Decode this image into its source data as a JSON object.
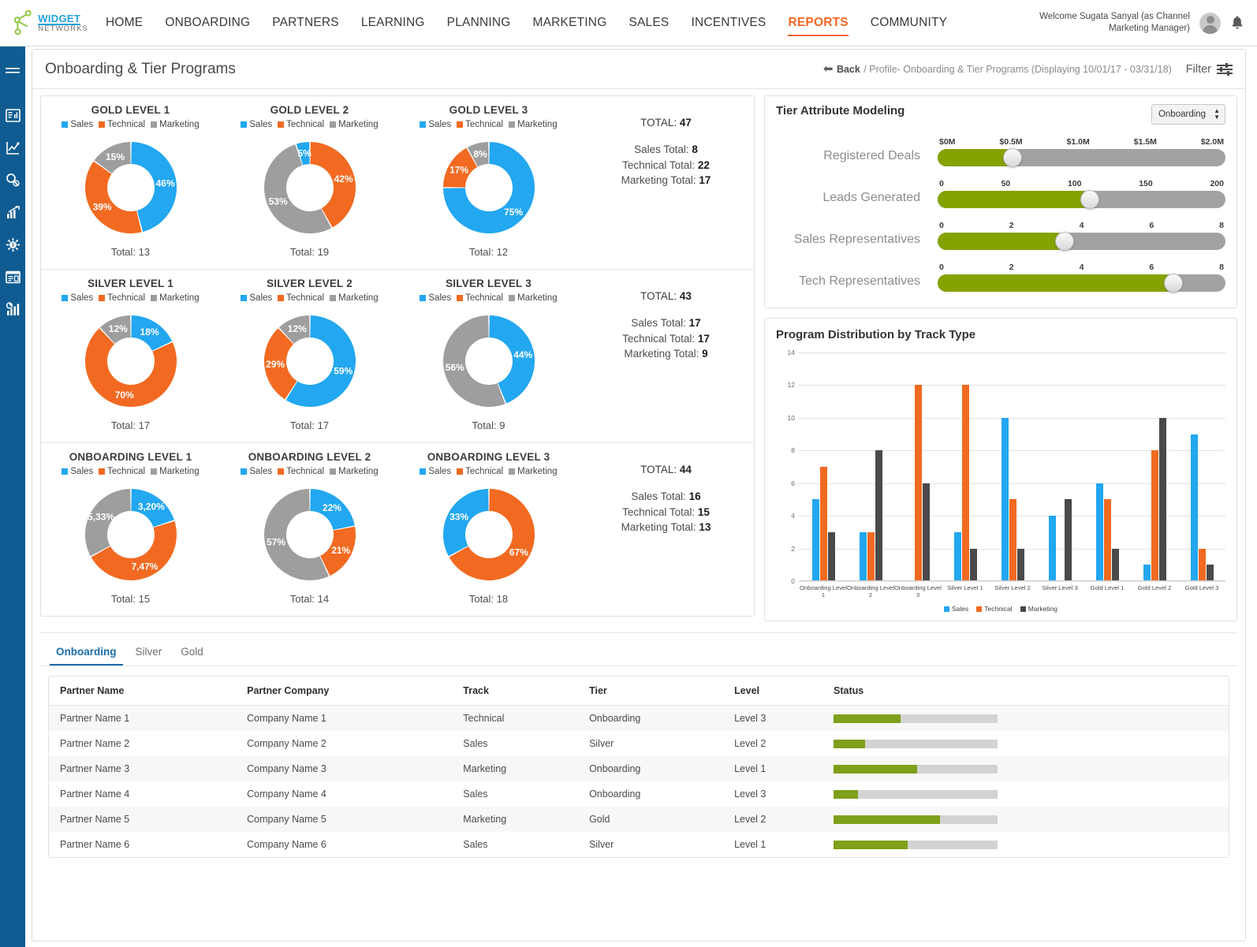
{
  "brand": {
    "name_top": "WIDGET",
    "name_bottom": "NETWORKS"
  },
  "nav": {
    "items": [
      {
        "label": "HOME",
        "active": false
      },
      {
        "label": "ONBOARDING",
        "active": false
      },
      {
        "label": "PARTNERS",
        "active": false
      },
      {
        "label": "LEARNING",
        "active": false
      },
      {
        "label": "PLANNING",
        "active": false
      },
      {
        "label": "MARKETING",
        "active": false
      },
      {
        "label": "SALES",
        "active": false
      },
      {
        "label": "INCENTIVES",
        "active": false
      },
      {
        "label": "REPORTS",
        "active": true
      },
      {
        "label": "COMMUNITY",
        "active": false
      }
    ],
    "welcome_line1": "Welcome Sugata Sanyal (as Channel",
    "welcome_line2": "Marketing Manager)",
    "accent_color": "#f26722"
  },
  "sidebar": {
    "items": [
      {
        "name": "hamburger-menu"
      },
      {
        "name": "report-invoice-icon"
      },
      {
        "name": "line-chart-icon"
      },
      {
        "name": "search-money-icon"
      },
      {
        "name": "growth-chart-icon"
      },
      {
        "name": "gear-money-icon"
      },
      {
        "name": "document-report-icon"
      },
      {
        "name": "bar-chart-icon"
      }
    ]
  },
  "page": {
    "title": "Onboarding & Tier Programs",
    "back_label": "Back",
    "breadcrumb": "/ Profile- Onboarding & Tier Programs (Displaying 10/01/17 - 03/31/18)",
    "filter_label": "Filter"
  },
  "legend": {
    "sales": "Sales",
    "technical": "Technical",
    "marketing": "Marketing"
  },
  "colors": {
    "sales": "#22a7f0",
    "technical": "#f26a21",
    "marketing": "#9e9e9e",
    "green": "#84a200",
    "bar_marketing": "#4a4a4a"
  },
  "donut_rows": [
    {
      "cells": [
        {
          "title": "GOLD LEVEL 1",
          "total_label": "Total: 13",
          "segments": [
            {
              "series": "sales",
              "pct": 46,
              "label": "46%"
            },
            {
              "series": "technical",
              "pct": 39,
              "label": "39%"
            },
            {
              "series": "marketing",
              "pct": 15,
              "label": "15%"
            }
          ]
        },
        {
          "title": "GOLD LEVEL 2",
          "total_label": "Total: 19",
          "segments": [
            {
              "series": "technical",
              "pct": 42,
              "label": "42%"
            },
            {
              "series": "marketing",
              "pct": 53,
              "label": "53%"
            },
            {
              "series": "sales",
              "pct": 5,
              "label": "5%"
            }
          ]
        },
        {
          "title": "GOLD LEVEL 3",
          "total_label": "Total: 12",
          "segments": [
            {
              "series": "sales",
              "pct": 75,
              "label": "75%"
            },
            {
              "series": "technical",
              "pct": 17,
              "label": "17%"
            },
            {
              "series": "marketing",
              "pct": 8,
              "label": "8%"
            }
          ]
        }
      ],
      "totals": {
        "total_label": "TOTAL:",
        "total_value": "47",
        "sales": "Sales Total:",
        "sales_value": "8",
        "technical": "Technical Total:",
        "technical_value": "22",
        "marketing": "Marketing Total:",
        "marketing_value": "17"
      }
    },
    {
      "cells": [
        {
          "title": "SILVER LEVEL 1",
          "total_label": "Total: 17",
          "segments": [
            {
              "series": "sales",
              "pct": 18,
              "label": "18%"
            },
            {
              "series": "technical",
              "pct": 70,
              "label": "70%"
            },
            {
              "series": "marketing",
              "pct": 12,
              "label": "12%"
            }
          ]
        },
        {
          "title": "SILVER LEVEL 2",
          "total_label": "Total: 17",
          "segments": [
            {
              "series": "sales",
              "pct": 59,
              "label": "59%"
            },
            {
              "series": "technical",
              "pct": 29,
              "label": "29%"
            },
            {
              "series": "marketing",
              "pct": 12,
              "label": "12%"
            }
          ]
        },
        {
          "title": "SILVER LEVEL 3",
          "total_label": "Total: 9",
          "segments": [
            {
              "series": "sales",
              "pct": 44,
              "label": "44%"
            },
            {
              "series": "marketing",
              "pct": 56,
              "label": "56%"
            }
          ]
        }
      ],
      "totals": {
        "total_label": "TOTAL:",
        "total_value": "43",
        "sales": "Sales Total:",
        "sales_value": "17",
        "technical": "Technical Total:",
        "technical_value": "17",
        "marketing": "Marketing Total:",
        "marketing_value": "9"
      }
    },
    {
      "cells": [
        {
          "title": "ONBOARDING LEVEL 1",
          "total_label": "Total: 15",
          "segments": [
            {
              "series": "sales",
              "pct": 20,
              "label": "3,20%"
            },
            {
              "series": "technical",
              "pct": 47,
              "label": "7,47%"
            },
            {
              "series": "marketing",
              "pct": 33,
              "label": "5,33%"
            }
          ]
        },
        {
          "title": "ONBOARDING LEVEL 2",
          "total_label": "Total: 14",
          "segments": [
            {
              "series": "sales",
              "pct": 22,
              "label": "22%"
            },
            {
              "series": "technical",
              "pct": 21,
              "label": "21%"
            },
            {
              "series": "marketing",
              "pct": 57,
              "label": "57%"
            }
          ]
        },
        {
          "title": "ONBOARDING LEVEL 3",
          "total_label": "Total: 18",
          "segments": [
            {
              "series": "technical",
              "pct": 67,
              "label": "67%"
            },
            {
              "series": "sales",
              "pct": 33,
              "label": "33%"
            }
          ]
        }
      ],
      "totals": {
        "total_label": "TOTAL:",
        "total_value": "44",
        "sales": "Sales Total:",
        "sales_value": "16",
        "technical": "Technical Total:",
        "technical_value": "15",
        "marketing": "Marketing Total:",
        "marketing_value": "13"
      }
    }
  ],
  "tier_modeling": {
    "title": "Tier Attribute Modeling",
    "selected": "Onboarding",
    "sliders": [
      {
        "label": "Registered Deals",
        "ticks": [
          "$0M",
          "$0.5M",
          "$1.0M",
          "$1.5M",
          "$2.0M"
        ],
        "value_pct": 26
      },
      {
        "label": "Leads Generated",
        "ticks": [
          "0",
          "50",
          "100",
          "150",
          "200"
        ],
        "value_pct": 53
      },
      {
        "label": "Sales Representatives",
        "ticks": [
          "0",
          "2",
          "4",
          "6",
          "8"
        ],
        "value_pct": 44
      },
      {
        "label": "Tech Representatives",
        "ticks": [
          "0",
          "2",
          "4",
          "6",
          "8"
        ],
        "value_pct": 82
      }
    ]
  },
  "chart_data": {
    "type": "bar",
    "title": "Program Distribution by Track Type",
    "xlabel": "",
    "ylabel": "",
    "ylim": [
      0,
      14
    ],
    "yticks": [
      0,
      2,
      4,
      6,
      8,
      10,
      12,
      14
    ],
    "grid": true,
    "legend_position": "bottom",
    "categories": [
      "Onboarding Level 1",
      "Onboarding Level 2",
      "Onboarding Level 3",
      "Silver Level 1",
      "Silver Level 2",
      "Silver Level 3",
      "Gold Level 1",
      "Gold Level 2",
      "Gold Level 3"
    ],
    "series": [
      {
        "name": "Sales",
        "color": "#22a7f0",
        "values": [
          5,
          3,
          0,
          3,
          10,
          4,
          6,
          1,
          9
        ]
      },
      {
        "name": "Technical",
        "color": "#f26a21",
        "values": [
          7,
          3,
          12,
          12,
          5,
          0,
          5,
          8,
          2
        ]
      },
      {
        "name": "Marketing",
        "color": "#4a4a4a",
        "values": [
          3,
          8,
          6,
          2,
          2,
          5,
          2,
          10,
          1
        ]
      }
    ]
  },
  "tabs": [
    {
      "label": "Onboarding",
      "active": true
    },
    {
      "label": "Silver",
      "active": false
    },
    {
      "label": "Gold",
      "active": false
    }
  ],
  "table": {
    "columns": [
      "Partner Name",
      "Partner Company",
      "Track",
      "Tier",
      "Level",
      "Status"
    ],
    "rows": [
      {
        "partner": "Partner Name 1",
        "company": "Company Name 1",
        "track": "Technical",
        "tier": "Onboarding",
        "level": "Level 3",
        "status_pct": 41
      },
      {
        "partner": "Partner Name 2",
        "company": "Company Name 2",
        "track": "Sales",
        "tier": "Silver",
        "level": "Level 2",
        "status_pct": 19
      },
      {
        "partner": "Partner Name 3",
        "company": "Company Name 3",
        "track": "Marketing",
        "tier": "Onboarding",
        "level": "Level 1",
        "status_pct": 51
      },
      {
        "partner": "Partner Name 4",
        "company": "Company Name 4",
        "track": "Sales",
        "tier": "Onboarding",
        "level": "Level 3",
        "status_pct": 15
      },
      {
        "partner": "Partner Name 5",
        "company": "Company Name 5",
        "track": "Marketing",
        "tier": "Gold",
        "level": "Level 2",
        "status_pct": 65
      },
      {
        "partner": "Partner Name 6",
        "company": "Company Name 6",
        "track": "Sales",
        "tier": "Silver",
        "level": "Level 1",
        "status_pct": 45
      }
    ]
  }
}
